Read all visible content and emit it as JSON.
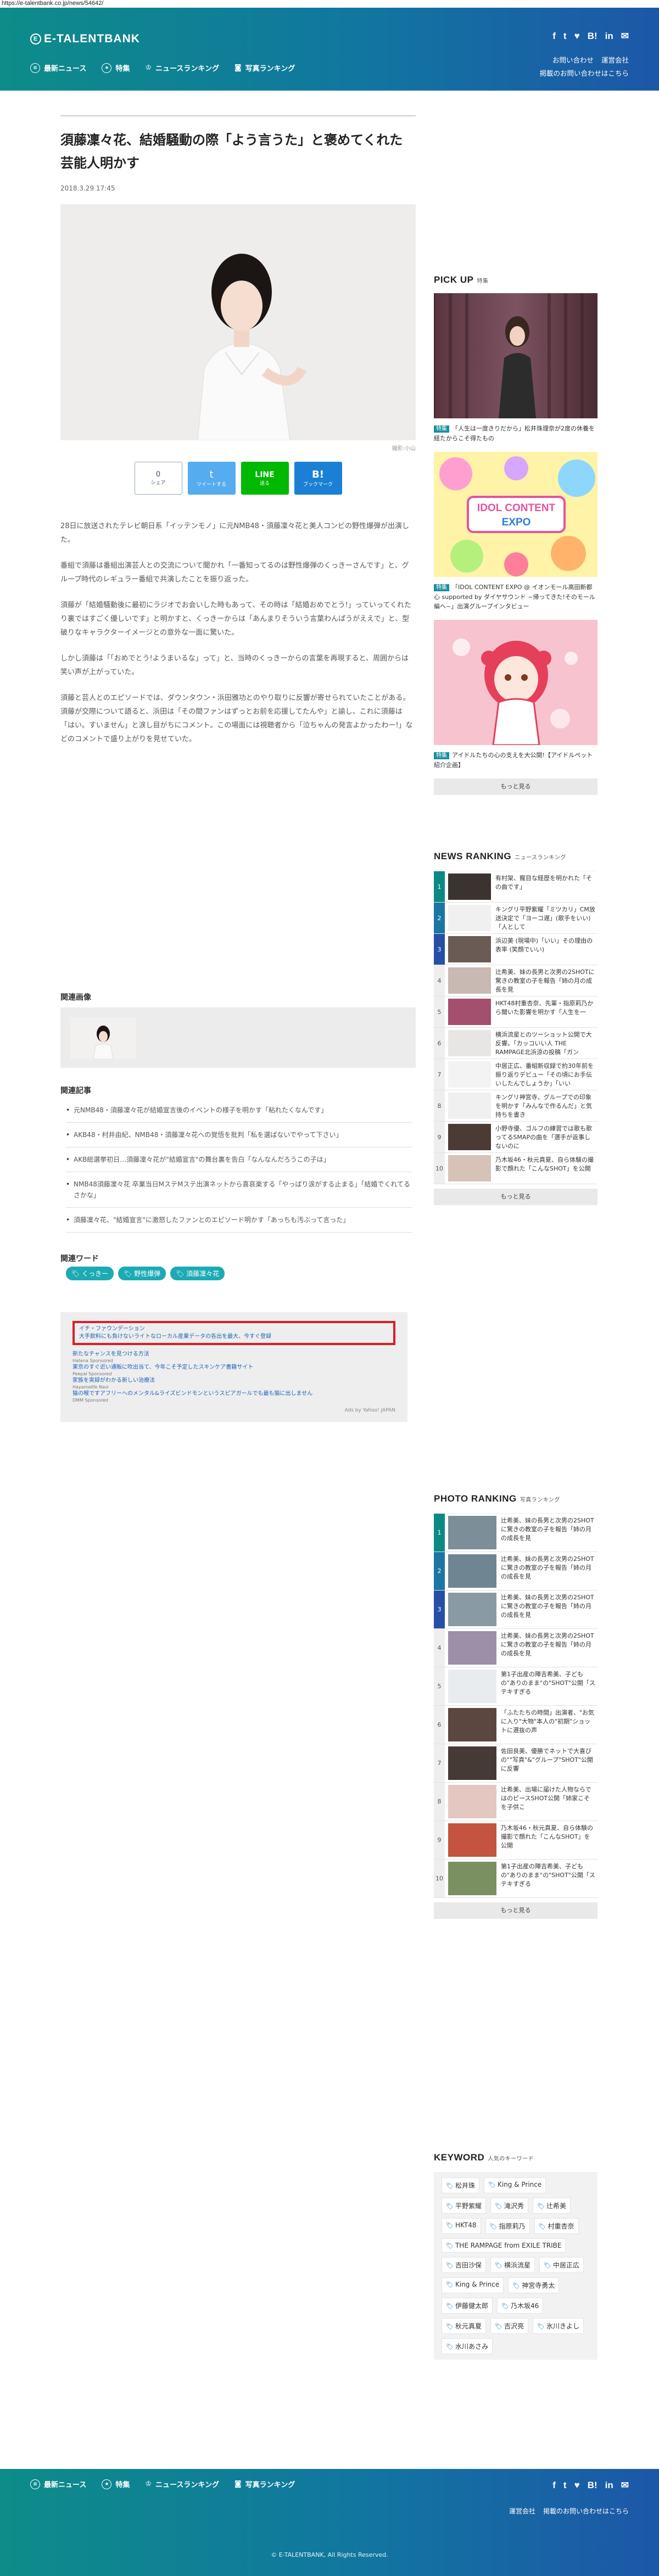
{
  "browser": {
    "url": "https://e-talentbank.co.jp/news/54642/"
  },
  "header": {
    "logo": "E-TALENTBANK",
    "nav": [
      {
        "icon": "news-icon",
        "label": "最新ニュース"
      },
      {
        "icon": "feature-icon",
        "label": "特集"
      },
      {
        "icon": "crown-icon",
        "label": "ニュースランキング"
      },
      {
        "icon": "camera-icon",
        "label": "写真ランキング"
      }
    ],
    "sns": [
      "f",
      "t",
      "♥",
      "B!",
      "in",
      "✉"
    ],
    "links": [
      "お問い合わせ",
      "運営会社",
      "掲載のお問い合わせはこちら"
    ]
  },
  "article": {
    "title": "須藤凜々花、結婚騒動の際「よう言うた」と褒めてくれた芸能人明かす",
    "date": "2018.3.29 17:45",
    "photo_credit": "撮影:小山",
    "share": {
      "count": "0",
      "count_label": "シェア",
      "twitter": "ツイートする",
      "line": "送る",
      "hatena": "ブックマーク"
    },
    "paragraphs": [
      "28日に放送されたテレビ朝日系「イッテンモノ」に元NMB48・須藤凜々花と美人コンビの野性爆弾が出演した。",
      "番組で須藤は番組出演芸人との交流について聞かれ「一番知ってるのは野性爆弾のくっきーさんです」と、グループ時代のレギュラー番組で共演したことを振り返った。",
      "須藤が「結婚騒動後に最初にラジオでお会いした時もあって、その時は「結婚おめでとう!」っていってくれたり裏ではすごく優しいです」と明かすと、くっきーからは「あんまりそういう言葉わんぱうがええで」と、型破りなキャラクターイメージとの意外な一面に驚いた。",
      "しかし須藤は「「おめでとう!ようまいるな」って」と、当時のくっきーからの言葉を再現すると、周囲からは笑い声が上がっていた。",
      "須藤と芸人とのエピソードでは、ダウンタウン・浜田雅功とのやり取りに反響が寄せられていたことがある。須藤が交際について語ると、浜田は「その間ファンはずっとお前を応援してたんや」と諭し、これに須藤は「はい。すいません」と涙し目がちにコメント。この場面には視聴者から「泣ちゃんの発言よかったわー!」などのコメントで盛り上がりを見せていた。"
    ]
  },
  "related": {
    "images_heading": "関連画像",
    "articles_heading": "関連記事",
    "articles": [
      "元NMB48・須藤凜々花が結婚宣言後のイベントの様子を明かす「粘れたくなんです」",
      "AKB48・村井由紀、NMB48・須藤凜々花への覚悟を批判「私を選ばないでやって下さい」",
      "AKB総選挙初日…須藤凜々花が\"結婚宣言\"の舞台裏を告白「なんなんだろうこの子は」",
      "NMB48須藤凜々花 卒業当日MステMステ出演ネットから喜哀楽する「やっぱり涙がする止まる」「結婚でくれてるさかな」",
      "須藤凜々花、\"結婚宣言\"に激怒したファンとのエピソード明かす「あっちも汚ぶって言った」"
    ],
    "words_heading": "関連ワード",
    "words": [
      "くっきー",
      "野性爆弾",
      "須藤凜々花"
    ]
  },
  "ads": {
    "highlight_title": "イチ・ファウンデーション",
    "highlight_sub": "大手飲料にも負けないライトなローカル産業データの各出を最大、今すぐ登録",
    "items": [
      {
        "title": "新たなチャンスを見つける方法",
        "src": "Hatena Sponsored"
      },
      {
        "title": "東京のすぐ近い通販に吹出当て、今年こそ予定したスキンケア書籍サイト",
        "src": "Peepal Sponsored"
      },
      {
        "title": "家族を実録がわかる新しい治療法",
        "src": "Hayamelife Navi"
      },
      {
        "title": "猫の喉ですアフリーへのメンタル&ライズビンドモンというスピアガールでも最も猫に出しません",
        "src": "DMM Sponsored"
      }
    ],
    "by": "Ads by Yahoo! JAPAN"
  },
  "sidebar": {
    "pickup": {
      "heading": "PICK UP",
      "sub": "特集",
      "badge": "特集",
      "items": [
        "「人生は一度きりだから」松井珠理奈が2度の休養を経たからこそ得たもの",
        "「IDOL CONTENT EXPO @ イオンモール高田新都心 supported by ダイヤサウンド ~帰ってきた!そのモール編へ~」出演グループインタビュー",
        "アイドルたちの心の支えを大公開!【アイドルペット紹介企画】"
      ],
      "more": "もっと見る"
    },
    "news_ranking": {
      "heading": "NEWS RANKING",
      "sub": "ニュースランキング",
      "items": [
        {
          "rank": "1",
          "text": "有村架、寵目な経歴を明かれた「その曲です」"
        },
        {
          "rank": "2",
          "text": "キングリ平野紫耀「ミツカリ」CM放送決定で「ヨーコ遅」(歌手をいい)「人として"
        },
        {
          "rank": "3",
          "text": "浜辺美 (現場中)「いい」その理由の表率 (笑顔でいい)"
        },
        {
          "rank": "4",
          "text": "辻希美、妹の長男と次男の2SHOTに驚きの教室の子を報告「姉の月の成長を見"
        },
        {
          "rank": "5",
          "text": "HKT48村重杏奈、先輩・指原莉乃から聞いた影響を明かす「人生を一"
        },
        {
          "rank": "6",
          "text": "横浜流星とのツーショット公開で大反響。「カッコいい人 THE RAMPAGE北浜涼の投稿「ガン"
        },
        {
          "rank": "7",
          "text": "中居正広、番組新収録で約30年前を振り返りデビュー「その頃にお手伝いしたんでしょうか」「いい"
        },
        {
          "rank": "8",
          "text": "キングリ神宮寺、グループでの印象を明かす「みんなで作るんだ」と気持ちを書き"
        },
        {
          "rank": "9",
          "text": "小野寺優、ゴルフの練習では歌も歌ってるSMAPの曲を「選手が返事しないのに"
        },
        {
          "rank": "10",
          "text": "乃木坂46・秋元真夏、自ら体験の撮影で顔れた「こんなSHOT」を公開"
        }
      ],
      "more": "もっと見る"
    },
    "photo_ranking": {
      "heading": "PHOTO RANKING",
      "sub": "写真ランキング",
      "items": [
        {
          "rank": "1",
          "text": "辻希美、妹の長男と次男の2SHOTに驚きの教室の子を報告「姉の月の成長を見"
        },
        {
          "rank": "2",
          "text": "辻希美、妹の長男と次男の2SHOTに驚きの教室の子を報告「姉の月の成長を見"
        },
        {
          "rank": "3",
          "text": "辻希美、妹の長男と次男の2SHOTに驚きの教室の子を報告「姉の月の成長を見"
        },
        {
          "rank": "4",
          "text": "辻希美、妹の長男と次男の2SHOTに驚きの教室の子を報告「姉の月の成長を見"
        },
        {
          "rank": "5",
          "text": "第1子出産の陣吉希美、子どもの\"ありのまま\"の\"SHOT\"公開「ステキすぎる"
        },
        {
          "rank": "6",
          "text": "「ふたたちの時間」出演者、\"お気に入り\"大物\"本人の\"初期\"ショットに選抜の声"
        },
        {
          "rank": "7",
          "text": "佐田良美、優勝でネットで大喜びの\"\"写真\"&\"グループ\"SHOT\"公開に反響"
        },
        {
          "rank": "8",
          "text": "辻希美、出場に届けた人物ならではのピースSHOT公開「姉家こそを子供こ"
        },
        {
          "rank": "9",
          "text": "乃木坂46・秋元真夏、自ら体験の撮影で顔れた「こんなSHOT」を公開"
        },
        {
          "rank": "10",
          "text": "第1子出産の陣吉希美、子どもの\"ありのまま\"の\"SHOT\"公開「ステキすぎる"
        }
      ],
      "more": "もっと見る"
    },
    "keyword": {
      "heading": "KEYWORD",
      "sub": "人気のキーワード",
      "items": [
        "松井珠",
        "King & Prince",
        "平野紫耀",
        "滝沢秀",
        "辻希美",
        "HKT48",
        "指原莉乃",
        "村重杏奈",
        "THE RAMPAGE from EXILE TRIBE",
        "吉田沙保",
        "横浜流星",
        "中居正広",
        "King & Prince",
        "神宮寺勇太",
        "伊藤健太郎",
        "乃木坂46",
        "秋元真夏",
        "吉沢亮",
        "氷川きよし",
        "水川あさみ"
      ]
    }
  },
  "footer": {
    "nav": [
      {
        "icon": "news-icon",
        "label": "最新ニュース"
      },
      {
        "icon": "feature-icon",
        "label": "特集"
      },
      {
        "icon": "crown-icon",
        "label": "ニュースランキング"
      },
      {
        "icon": "camera-icon",
        "label": "写真ランキング"
      }
    ],
    "sns": [
      "f",
      "t",
      "♥",
      "B!",
      "in",
      "✉"
    ],
    "links": [
      "運営会社",
      "掲載のお問い合わせはこちら"
    ],
    "copyright": "© E-TALENTBANK, All Rights Reserved."
  }
}
